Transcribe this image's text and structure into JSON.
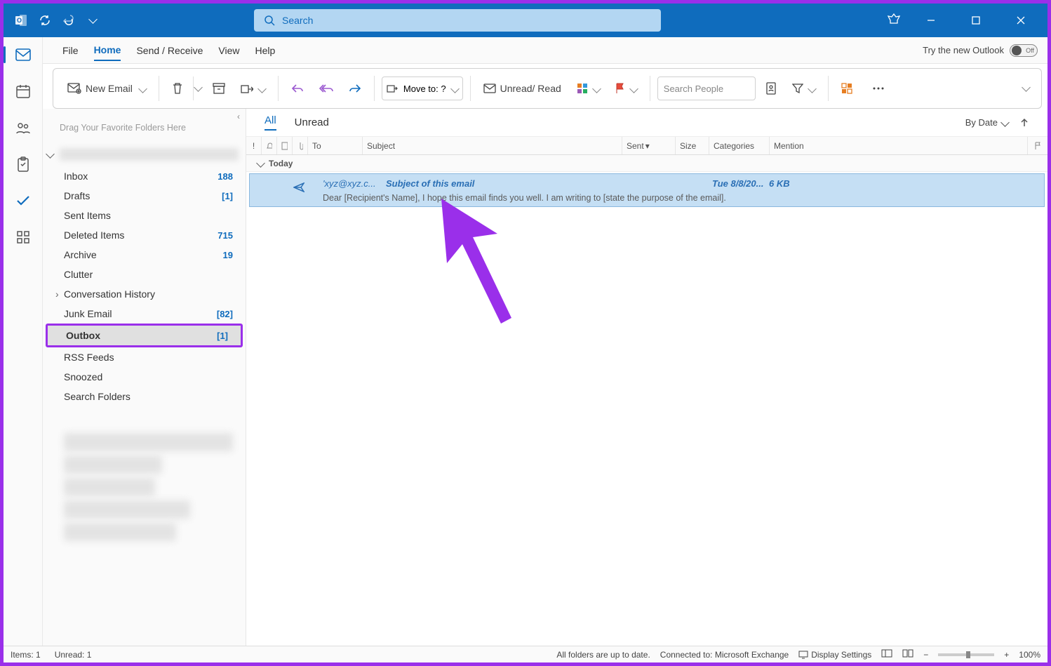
{
  "titlebar": {
    "search_placeholder": "Search"
  },
  "ribbon": {
    "tabs": [
      "File",
      "Home",
      "Send / Receive",
      "View",
      "Help"
    ],
    "active_tab": "Home",
    "try_new_label": "Try the new Outlook",
    "toggle_state": "Off",
    "new_email": "New Email",
    "move_to": "Move to: ?",
    "unread_read": "Unread/ Read",
    "search_people_placeholder": "Search People"
  },
  "folders": {
    "favorites_hint": "Drag Your Favorite Folders Here",
    "items": [
      {
        "name": "Inbox",
        "count": "188"
      },
      {
        "name": "Drafts",
        "count": "[1]"
      },
      {
        "name": "Sent Items",
        "count": ""
      },
      {
        "name": "Deleted Items",
        "count": "715"
      },
      {
        "name": "Archive",
        "count": "19"
      },
      {
        "name": "Clutter",
        "count": ""
      },
      {
        "name": "Conversation History",
        "count": "",
        "sub": true
      },
      {
        "name": "Junk Email",
        "count": "[82]"
      },
      {
        "name": "Outbox",
        "count": "[1]",
        "selected": true,
        "highlight": true
      },
      {
        "name": "RSS Feeds",
        "count": ""
      },
      {
        "name": "Snoozed",
        "count": ""
      },
      {
        "name": "Search Folders",
        "count": ""
      }
    ]
  },
  "message_list": {
    "filters": {
      "all": "All",
      "unread": "Unread"
    },
    "sort_label": "By Date",
    "columns": {
      "to": "To",
      "subject": "Subject",
      "sent": "Sent",
      "size": "Size",
      "categories": "Categories",
      "mention": "Mention"
    },
    "group_today": "Today",
    "message": {
      "to": "'xyz@xyz.c...",
      "subject": "Subject of this email",
      "sent": "Tue 8/8/20...",
      "size": "6 KB",
      "preview": "Dear [Recipient's Name],  I hope this email finds you well.  I am writing to [state the purpose of the email]."
    }
  },
  "statusbar": {
    "items": "Items: 1",
    "unread": "Unread: 1",
    "sync": "All folders are up to date.",
    "connection": "Connected to: Microsoft Exchange",
    "display_settings": "Display Settings",
    "zoom": "100%"
  }
}
